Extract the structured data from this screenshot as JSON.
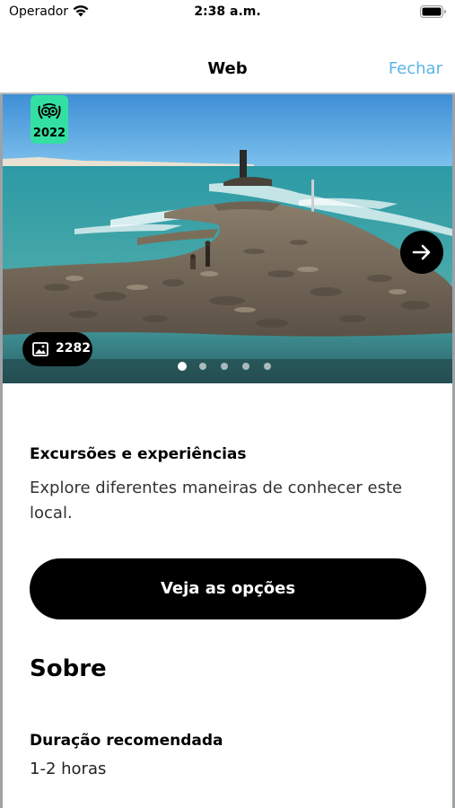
{
  "status_bar": {
    "carrier": "Operador",
    "time": "2:38 a.m."
  },
  "navbar": {
    "title": "Web",
    "close_label": "Fechar"
  },
  "hero": {
    "award_year": "2022",
    "photo_count": "2282",
    "carousel": {
      "total": 5,
      "active_index": 0
    },
    "next_icon": "arrow-right-icon",
    "photos_icon": "image-icon",
    "award_icon": "owl-laurel-icon"
  },
  "experiences": {
    "title": "Excursões e experiências",
    "description": "Explore diferentes maneiras de conhecer este local.",
    "cta_label": "Veja as opções"
  },
  "about": {
    "title": "Sobre",
    "duration_label": "Duração recomendada",
    "duration_value": "1-2 horas"
  },
  "colors": {
    "accent_link": "#5ab4e6",
    "badge_green": "#34e0a1",
    "button_black": "#000000"
  }
}
